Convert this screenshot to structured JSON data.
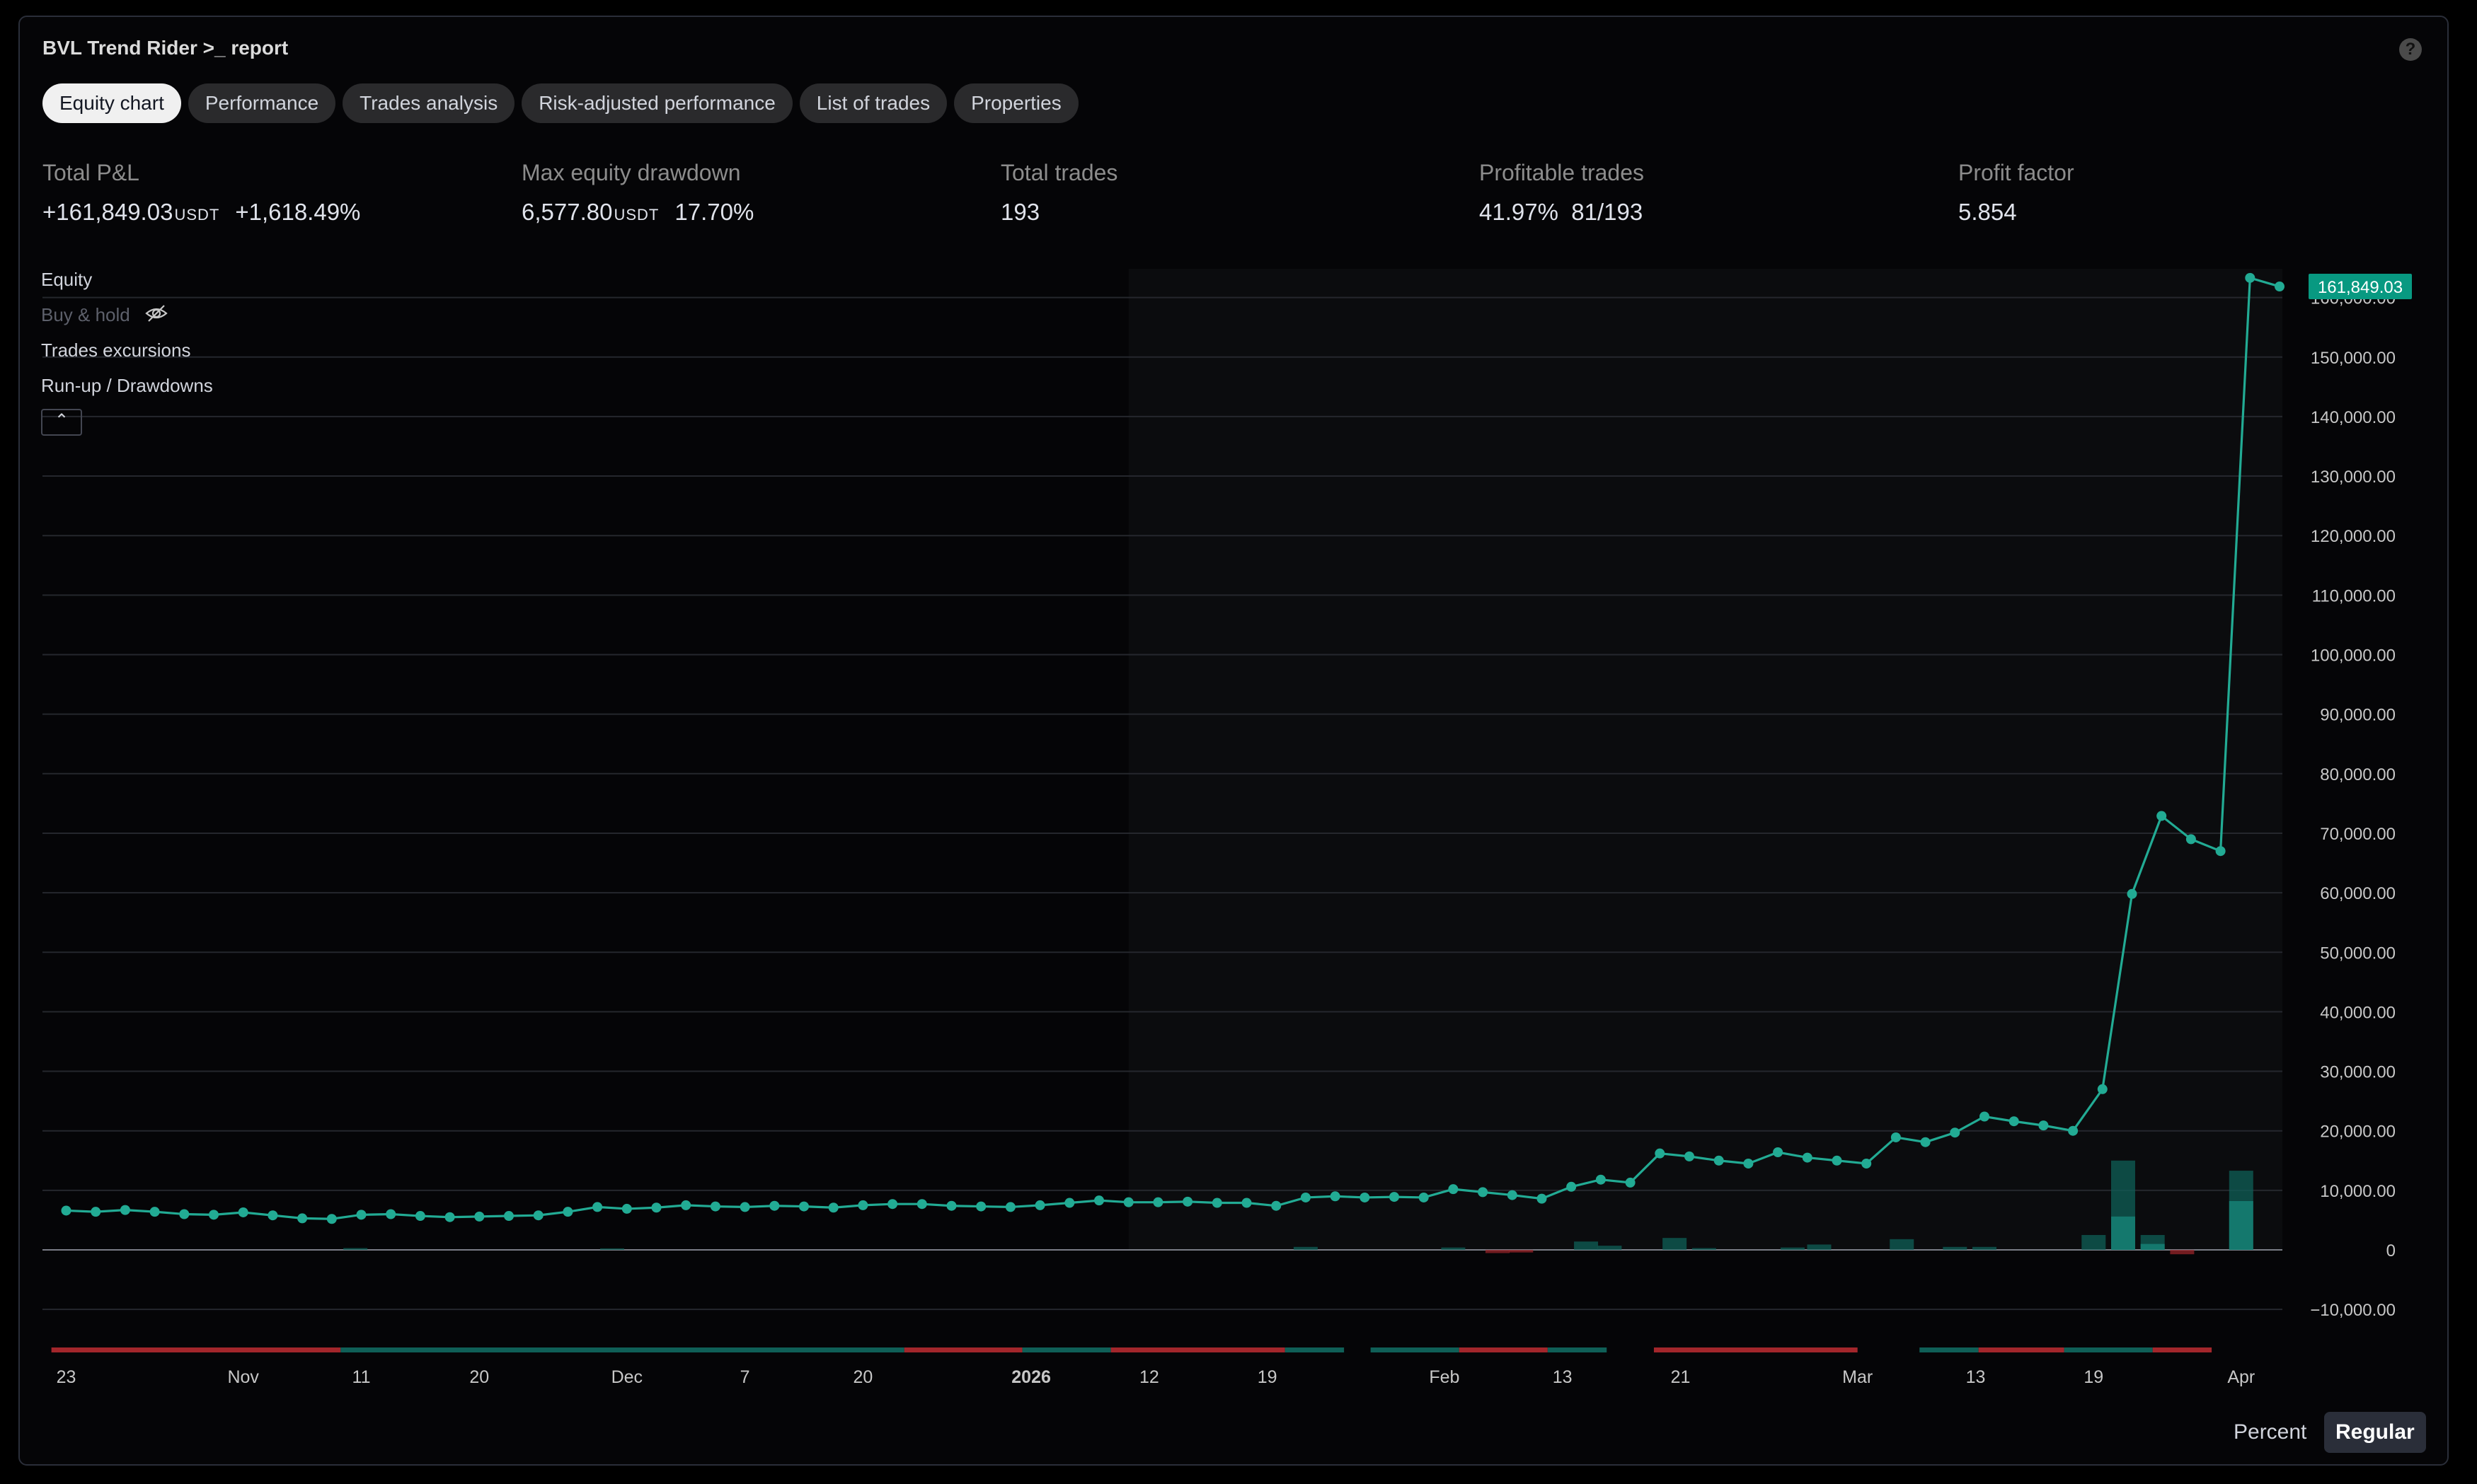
{
  "title": "BVL Trend Rider >_ report",
  "tabs": [
    {
      "label": "Equity chart",
      "active": true
    },
    {
      "label": "Performance",
      "active": false
    },
    {
      "label": "Trades analysis",
      "active": false
    },
    {
      "label": "Risk-adjusted performance",
      "active": false
    },
    {
      "label": "List of trades",
      "active": false
    },
    {
      "label": "Properties",
      "active": false
    }
  ],
  "metrics": {
    "total_pnl": {
      "label": "Total P&L",
      "value": "+161,849.03",
      "unit": "USDT",
      "percent": "+1,618.49%"
    },
    "max_drawdown": {
      "label": "Max equity drawdown",
      "value": "6,577.80",
      "unit": "USDT",
      "percent": "17.70%"
    },
    "total_trades": {
      "label": "Total trades",
      "value": "193"
    },
    "profitable_trades": {
      "label": "Profitable trades",
      "percent": "41.97%",
      "ratio": "81/193"
    },
    "profit_factor": {
      "label": "Profit factor",
      "value": "5.854"
    }
  },
  "legend": {
    "equity": "Equity",
    "buy_hold": "Buy & hold",
    "excursions": "Trades excursions",
    "runup": "Run-up / Drawdowns"
  },
  "buttons": {
    "percent": "Percent",
    "regular": "Regular"
  },
  "colors": {
    "equity": "#22ab94",
    "accent_label": "#089981",
    "bar_teal": "#0f5f57",
    "bar_red": "#a3262b"
  },
  "chart_data": {
    "type": "line",
    "series": [
      {
        "name": "Equity",
        "x": [
          1,
          2,
          3,
          4,
          5,
          6,
          7,
          8,
          9,
          10,
          11,
          12,
          13,
          14,
          15,
          16,
          17,
          18,
          19,
          20,
          21,
          22,
          23,
          24,
          25,
          26,
          27,
          28,
          29,
          30,
          31,
          32,
          33,
          34,
          35,
          36,
          37,
          38,
          39,
          40,
          41,
          42,
          43,
          44,
          45,
          46,
          47,
          48,
          49,
          50,
          51,
          52,
          53,
          54,
          55,
          56,
          57,
          58,
          59,
          60,
          61,
          62,
          63,
          64,
          65,
          66,
          67,
          68,
          69,
          70,
          71,
          72,
          73,
          74,
          75,
          76
        ],
        "y": [
          6600,
          6400,
          6700,
          6400,
          6000,
          5900,
          6300,
          5800,
          5300,
          5200,
          5900,
          6000,
          5700,
          5500,
          5600,
          5700,
          5800,
          6400,
          7200,
          6900,
          7100,
          7500,
          7300,
          7200,
          7400,
          7300,
          7100,
          7500,
          7700,
          7700,
          7400,
          7300,
          7200,
          7500,
          7900,
          8300,
          8000,
          8000,
          8100,
          7900,
          7900,
          7400,
          8800,
          9000,
          8800,
          8900,
          8800,
          10200,
          9700,
          9200,
          8600,
          10600,
          11800,
          11300,
          16200,
          15700,
          15000,
          14500,
          16400,
          15500,
          15000,
          14500,
          18900,
          18100,
          19700,
          22400,
          21600,
          20900,
          20000,
          27000,
          59800,
          72900,
          69000,
          67000,
          163300,
          161849.03
        ]
      }
    ],
    "last_value_label": "161,849.03",
    "ylim": [
      -10000,
      163300
    ],
    "y_ticks": [
      -10000,
      0,
      10000,
      20000,
      30000,
      40000,
      50000,
      60000,
      70000,
      80000,
      90000,
      100000,
      110000,
      120000,
      130000,
      140000,
      150000,
      160000
    ],
    "y_tick_labels": [
      "−10,000.00",
      "0",
      "10,000.00",
      "20,000.00",
      "30,000.00",
      "40,000.00",
      "50,000.00",
      "60,000.00",
      "70,000.00",
      "80,000.00",
      "90,000.00",
      "100,000.00",
      "110,000.00",
      "120,000.00",
      "130,000.00",
      "140,000.00",
      "150,000.00",
      "160,000.00"
    ],
    "x_ticks": [
      {
        "label": "23",
        "x": 1.0
      },
      {
        "label": "Nov",
        "x": 7.0
      },
      {
        "label": "11",
        "x": 11.0
      },
      {
        "label": "20",
        "x": 15.0
      },
      {
        "label": "Dec",
        "x": 20.0
      },
      {
        "label": "7",
        "x": 24.0
      },
      {
        "label": "20",
        "x": 28.0
      },
      {
        "label": "2026",
        "x": 33.7,
        "bold": true
      },
      {
        "label": "12",
        "x": 37.7
      },
      {
        "label": "19",
        "x": 41.7
      },
      {
        "label": "Feb",
        "x": 47.7
      },
      {
        "label": "13",
        "x": 51.7
      },
      {
        "label": "21",
        "x": 55.7
      },
      {
        "label": "Mar",
        "x": 61.7
      },
      {
        "label": "13",
        "x": 65.7
      },
      {
        "label": "19",
        "x": 69.7
      },
      {
        "label": "Apr",
        "x": 74.7
      }
    ],
    "runup_bars": [
      {
        "x": 10.8,
        "v": 300
      },
      {
        "x": 19.5,
        "v": 250
      },
      {
        "x": 43,
        "v": 500
      },
      {
        "x": 48,
        "v": 400
      },
      {
        "x": 52.5,
        "v": 1400
      },
      {
        "x": 53.3,
        "v": 700
      },
      {
        "x": 55.5,
        "v": 2000
      },
      {
        "x": 56.5,
        "v": 300
      },
      {
        "x": 59.5,
        "v": 400
      },
      {
        "x": 60.4,
        "v": 900
      },
      {
        "x": 63.2,
        "v": 1800
      },
      {
        "x": 65,
        "v": 500
      },
      {
        "x": 66,
        "v": 500
      },
      {
        "x": 69.7,
        "v": 2500
      },
      {
        "x": 70.7,
        "v": 15000,
        "inner": 5600
      },
      {
        "x": 71.7,
        "v": 2500,
        "inner": 1000
      },
      {
        "x": 74.7,
        "v": 13300,
        "inner": 8200
      }
    ],
    "drawdown_bars": [
      {
        "x": 49.5,
        "v": 300
      },
      {
        "x": 50.3,
        "v": 200
      },
      {
        "x": 72.7,
        "v": 500
      }
    ],
    "trade_strip": [
      {
        "from": 0.5,
        "to": 10.3,
        "c": "red"
      },
      {
        "from": 10.3,
        "to": 29.4,
        "c": "teal"
      },
      {
        "from": 29.4,
        "to": 33.4,
        "c": "red"
      },
      {
        "from": 33.4,
        "to": 36.4,
        "c": "teal"
      },
      {
        "from": 36.4,
        "to": 42.3,
        "c": "red"
      },
      {
        "from": 42.3,
        "to": 44.3,
        "c": "teal"
      },
      {
        "from": 45.2,
        "to": 48.2,
        "c": "teal"
      },
      {
        "from": 48.2,
        "to": 51.2,
        "c": "red"
      },
      {
        "from": 51.2,
        "to": 53.2,
        "c": "teal"
      },
      {
        "from": 54.8,
        "to": 61.7,
        "c": "red"
      },
      {
        "from": 63.8,
        "to": 65.8,
        "c": "teal"
      },
      {
        "from": 65.8,
        "to": 68.7,
        "c": "red"
      },
      {
        "from": 68.7,
        "to": 71.7,
        "c": "teal"
      },
      {
        "from": 71.7,
        "to": 73.7,
        "c": "red"
      }
    ]
  }
}
